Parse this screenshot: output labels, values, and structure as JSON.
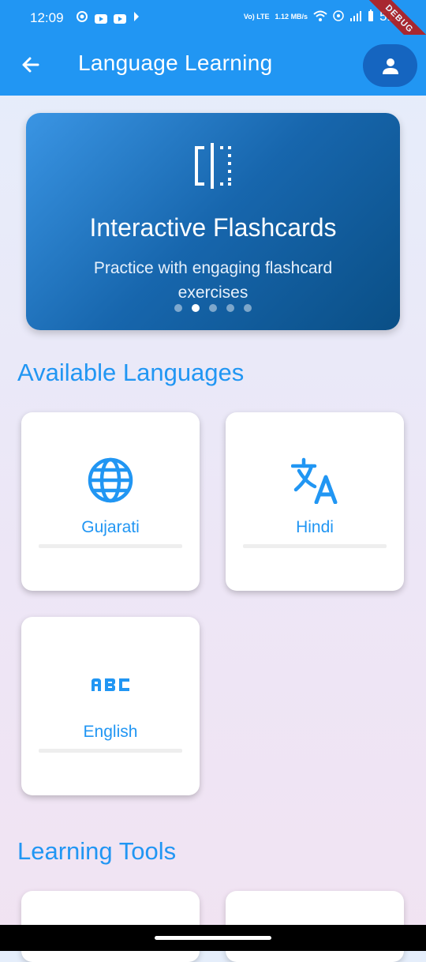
{
  "status_bar": {
    "time": "12:09",
    "network": "Vo) LTE",
    "speed": "1.12 MB/s",
    "battery": "51",
    "debug_label": "DEBUG"
  },
  "app_bar": {
    "title": "Language Learning",
    "back_icon": "arrow-back-icon",
    "profile_icon": "person-icon"
  },
  "banner": {
    "title": "Interactive Flashcards",
    "subtitle": "Practice with engaging flashcard exercises",
    "icon": "flip-card-icon",
    "page_count": 5,
    "active_page": 2
  },
  "languages_section": {
    "title": "Available Languages",
    "items": [
      {
        "name": "Gujarati",
        "icon": "globe-icon",
        "progress": 0
      },
      {
        "name": "Hindi",
        "icon": "translate-icon",
        "progress": 0
      },
      {
        "name": "English",
        "icon": "abc-icon",
        "progress": 0
      }
    ]
  },
  "tools_section": {
    "title": "Learning Tools"
  },
  "colors": {
    "primary": "#2196f3",
    "primary_dark": "#1565c0",
    "card": "#ffffff"
  }
}
